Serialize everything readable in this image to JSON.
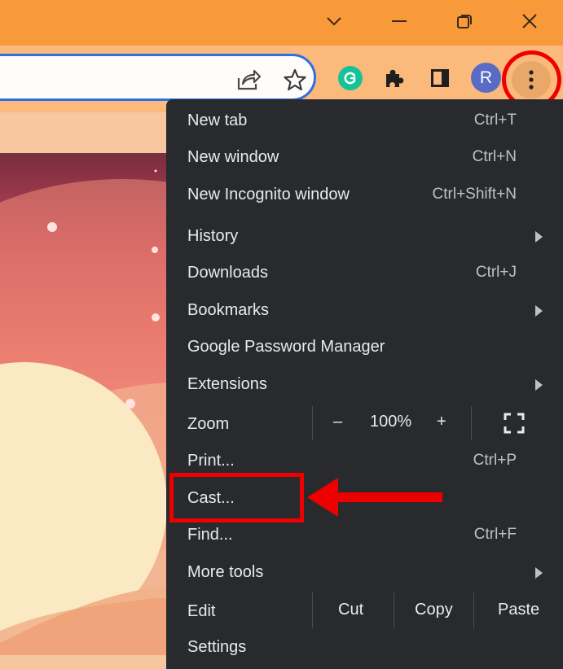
{
  "window_controls": {
    "tab_search_icon": "chevron-down-icon",
    "minimize_icon": "minimize-icon",
    "restore_icon": "restore-icon",
    "close_icon": "close-icon"
  },
  "toolbar": {
    "share_icon": "share-icon",
    "bookmark_icon": "star-icon",
    "extensions": [
      "grammarly-icon",
      "puzzle-icon",
      "side-panel-icon"
    ],
    "profile_initial": "R",
    "menu_icon": "vertical-dots-icon"
  },
  "menu": {
    "new_tab": {
      "label": "New tab",
      "shortcut": "Ctrl+T"
    },
    "new_window": {
      "label": "New window",
      "shortcut": "Ctrl+N"
    },
    "new_incognito": {
      "label": "New Incognito window",
      "shortcut": "Ctrl+Shift+N"
    },
    "history": {
      "label": "History"
    },
    "downloads": {
      "label": "Downloads",
      "shortcut": "Ctrl+J"
    },
    "bookmarks": {
      "label": "Bookmarks"
    },
    "password_manager": {
      "label": "Google Password Manager"
    },
    "extensions": {
      "label": "Extensions"
    },
    "zoom": {
      "label": "Zoom",
      "minus": "–",
      "value": "100%",
      "plus": "+"
    },
    "print": {
      "label": "Print...",
      "shortcut": "Ctrl+P"
    },
    "cast": {
      "label": "Cast..."
    },
    "find": {
      "label": "Find...",
      "shortcut": "Ctrl+F"
    },
    "more_tools": {
      "label": "More tools"
    },
    "edit": {
      "label": "Edit",
      "cut": "Cut",
      "copy": "Copy",
      "paste": "Paste"
    },
    "settings": {
      "label": "Settings"
    }
  },
  "colors": {
    "titlebar": "#f99a3a",
    "menu_bg": "#292a2d",
    "highlight": "#ee0000",
    "omnibox_border": "#2f6fe4"
  }
}
